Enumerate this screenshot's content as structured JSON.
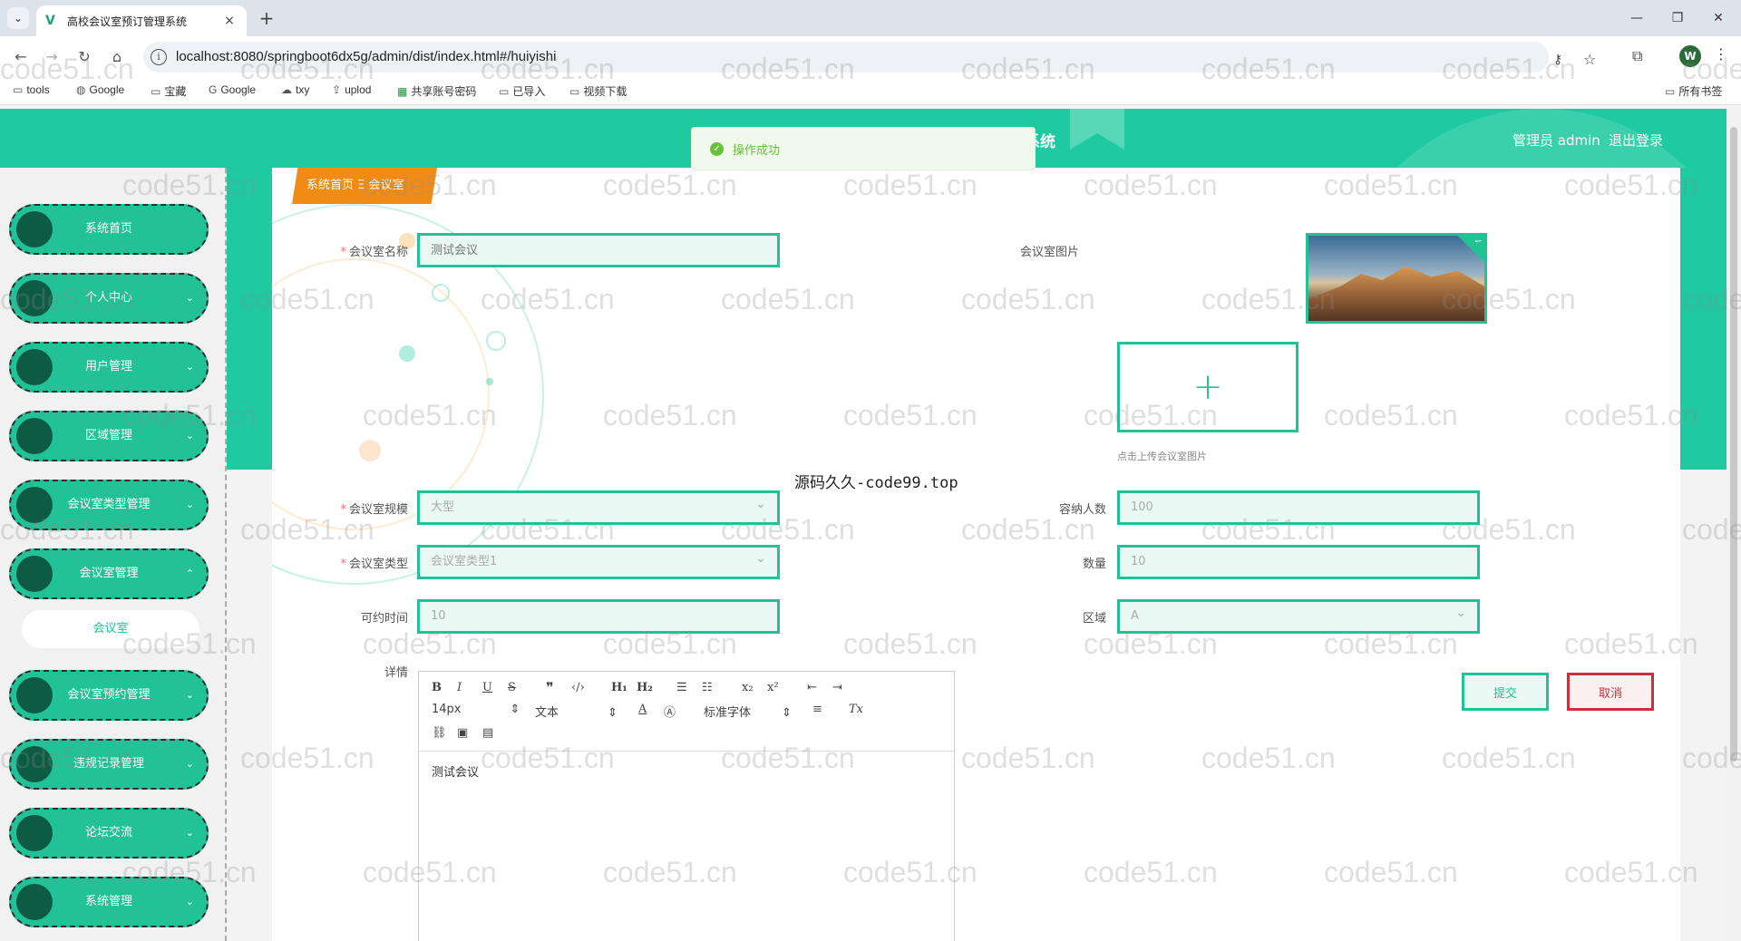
{
  "browser": {
    "tab_title": "高校会议室预订管理系统",
    "url": "localhost:8080/springboot6dx5g/admin/dist/index.html#/huiyishi",
    "bookmarks": [
      {
        "label": "tools",
        "icon": "folder-icon"
      },
      {
        "label": "Google",
        "icon": "globe-icon"
      },
      {
        "label": "宝藏",
        "icon": "folder-icon"
      },
      {
        "label": "Google",
        "icon": "google-icon"
      },
      {
        "label": "txy",
        "icon": "cloud-icon"
      },
      {
        "label": "uplod",
        "icon": "upload-icon"
      },
      {
        "label": "共享账号密码",
        "icon": "sheet-icon"
      },
      {
        "label": "已导入",
        "icon": "folder-icon"
      },
      {
        "label": "视频下载",
        "icon": "folder-icon"
      }
    ],
    "all_bookmarks": "所有书签",
    "profile_initial": "W"
  },
  "header": {
    "title_fragment": "系统",
    "user": "管理员 admin",
    "logout": "退出登录",
    "accent_color": "#1fcaa0"
  },
  "toast": {
    "text": "操作成功"
  },
  "sidebar": {
    "items": [
      {
        "label": "系统首页",
        "chevron": ""
      },
      {
        "label": "个人中心",
        "chevron": "⌄"
      },
      {
        "label": "用户管理",
        "chevron": "⌄"
      },
      {
        "label": "区域管理",
        "chevron": "⌄"
      },
      {
        "label": "会议室类型管理",
        "chevron": "⌄"
      },
      {
        "label": "会议室管理",
        "chevron": "⌃"
      },
      {
        "label": "会议室预约管理",
        "chevron": "⌄"
      },
      {
        "label": "违规记录管理",
        "chevron": "⌄"
      },
      {
        "label": "论坛交流",
        "chevron": "⌄"
      },
      {
        "label": "系统管理",
        "chevron": "⌄"
      }
    ],
    "submenu": "会议室"
  },
  "breadcrumb": {
    "home": "系统首页",
    "current": "会议室"
  },
  "form": {
    "name_label": "会议室名称",
    "name_placeholder": "测试会议",
    "image_label": "会议室图片",
    "upload_hint": "点击上传会议室图片",
    "scale_label": "会议室规模",
    "scale_value": "大型",
    "capacity_label": "容纳人数",
    "capacity_value": "100",
    "type_label": "会议室类型",
    "type_value": "会议室类型1",
    "quantity_label": "数量",
    "quantity_value": "10",
    "time_label": "可约时间",
    "time_value": "10",
    "area_label": "区域",
    "area_value": "A",
    "detail_label": "详情",
    "editor": {
      "font_size": "14px",
      "text_type": "文本",
      "font_family": "标准字体",
      "content": "测试会议"
    },
    "submit": "提交",
    "cancel": "取消"
  },
  "overlay_text": "源码久久-code99.top",
  "watermark": "code51.cn"
}
